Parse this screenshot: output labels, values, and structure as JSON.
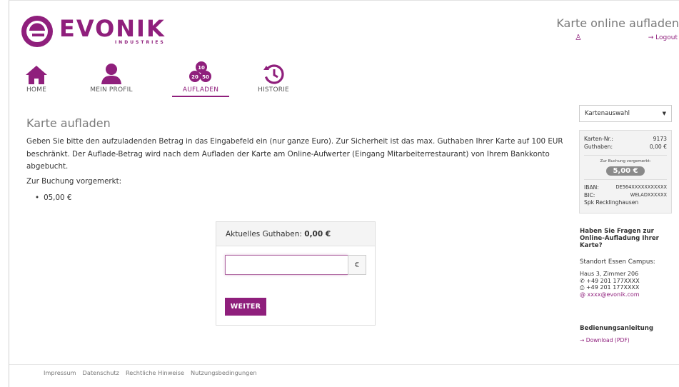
{
  "header": {
    "logo_word": "EVONIK",
    "logo_sub": "INDUSTRIES",
    "page_title": "Karte online aufladen",
    "user_icon": "user-icon",
    "logout_label": "→ Logout"
  },
  "nav": {
    "items": [
      {
        "label": "HOME",
        "icon": "home-icon"
      },
      {
        "label": "MEIN PROFIL",
        "icon": "profile-icon"
      },
      {
        "label": "AUFLADEN",
        "icon": "coins-icon",
        "active": true
      },
      {
        "label": "HISTORIE",
        "icon": "history-icon"
      }
    ],
    "coin_numbers": [
      "10",
      "20",
      "50"
    ]
  },
  "main": {
    "title": "Karte aufladen",
    "intro": "Geben Sie bitte den aufzuladenden Betrag in das Eingabefeld ein (nur ganze Euro). Zur Sicherheit ist das max. Guthaben Ihrer Karte auf 100 EUR beschränkt. Der Auflade-Betrag wird nach dem Aufladen der Karte am Online-Aufwerter (Eingang Mitarbeiterrestaurant) von Ihrem Bankkonto abgebucht.",
    "booked_label": "Zur Buchung vorgemerkt:",
    "booked_items": [
      "05,00 €"
    ]
  },
  "topup": {
    "balance_label": "Aktuelles Guthaben:",
    "balance_value": "0,00 €",
    "amount_value": "",
    "currency": "€",
    "submit_label": "WEITER"
  },
  "sidebar": {
    "card_select": "Kartenauswahl",
    "card_no_label": "Karten-Nr.:",
    "card_no": "9173",
    "balance_label": "Guthaben:",
    "balance": "0,00 €",
    "booked_label": "Zur Buchung vorgemerkt:",
    "booked_value": "5,00 €",
    "iban_label": "IBAN:",
    "iban": "DE564XXXXXXXXXXX",
    "bic_label": "BIC:",
    "bic": "WELADXXXXXX",
    "bank_name": "Spk Recklinghausen",
    "faq_title": "Haben Sie Fragen zur Online-Aufladung Ihrer Karte?",
    "location_title": "Standort Essen Campus:",
    "room": "Haus 3, Zimmer 206",
    "phone": "+49 201 177XXXX",
    "fax": "+49 201 177XXXX",
    "email": "xxxx@evonik.com",
    "manual_title": "Bedienungsanleitung",
    "manual_link": "→ Download (PDF)"
  },
  "footer": {
    "links": [
      "Impressum",
      "Datenschutz",
      "Rechtliche Hinweise",
      "Nutzungsbedingungen"
    ]
  },
  "colors": {
    "brand": "#8f1f7c",
    "text": "#333333",
    "muted": "#7a7a7a"
  }
}
